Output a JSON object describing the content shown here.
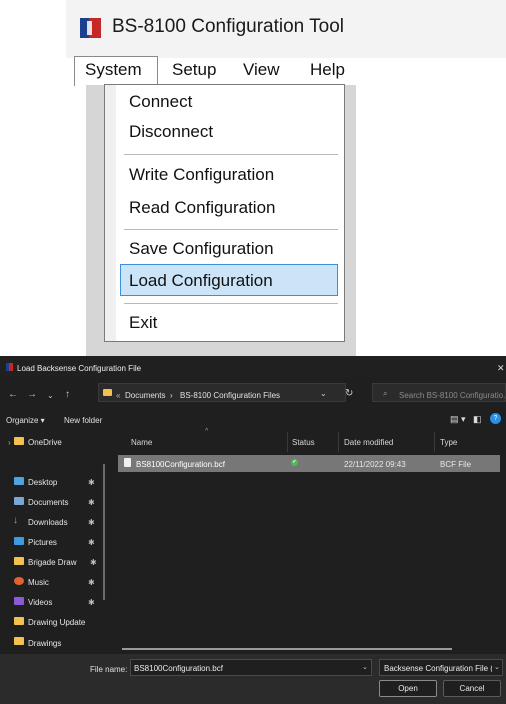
{
  "app": {
    "title": "BS-8100 Configuration Tool",
    "menubar": [
      "System",
      "Setup",
      "View",
      "Help"
    ],
    "system_menu": {
      "items": [
        "Connect",
        "Disconnect",
        "Write Configuration",
        "Read Configuration",
        "Save Configuration",
        "Load Configuration",
        "Exit"
      ],
      "highlighted": "Load Configuration"
    }
  },
  "dialog": {
    "title": "Load Backsense Configuration File",
    "breadcrumb": {
      "overflow": "«",
      "parts": [
        "Documents",
        "›",
        "BS-8100 Configuration Files"
      ]
    },
    "search_placeholder": "Search BS-8100 Configuratio...",
    "commands": {
      "organize": "Organize ▾",
      "new_folder": "New folder"
    },
    "nav": {
      "onedrive": "OneDrive",
      "items": [
        "Desktop",
        "Documents",
        "Downloads",
        "Pictures",
        "Brigade Draw",
        "Music",
        "Videos",
        "Drawing Update",
        "Drawings"
      ]
    },
    "columns": [
      "Name",
      "Status",
      "Date modified",
      "Type"
    ],
    "files": [
      {
        "name": "BS8100Configuration.bcf",
        "status": "✔",
        "modified": "22/11/2022 09:43",
        "type": "BCF File"
      }
    ],
    "filename_label": "File name:",
    "filename_value": "BS8100Configuration.bcf",
    "filter": "Backsense Configuration File (*",
    "open_label": "Open",
    "cancel_label": "Cancel"
  },
  "colors": {
    "menu_highlight": "#cce4f7",
    "menu_highlight_border": "#3d8fd8",
    "dialog_bg": "#1f1f1f",
    "folder": "#f2c14e",
    "selected_row": "#777777"
  }
}
